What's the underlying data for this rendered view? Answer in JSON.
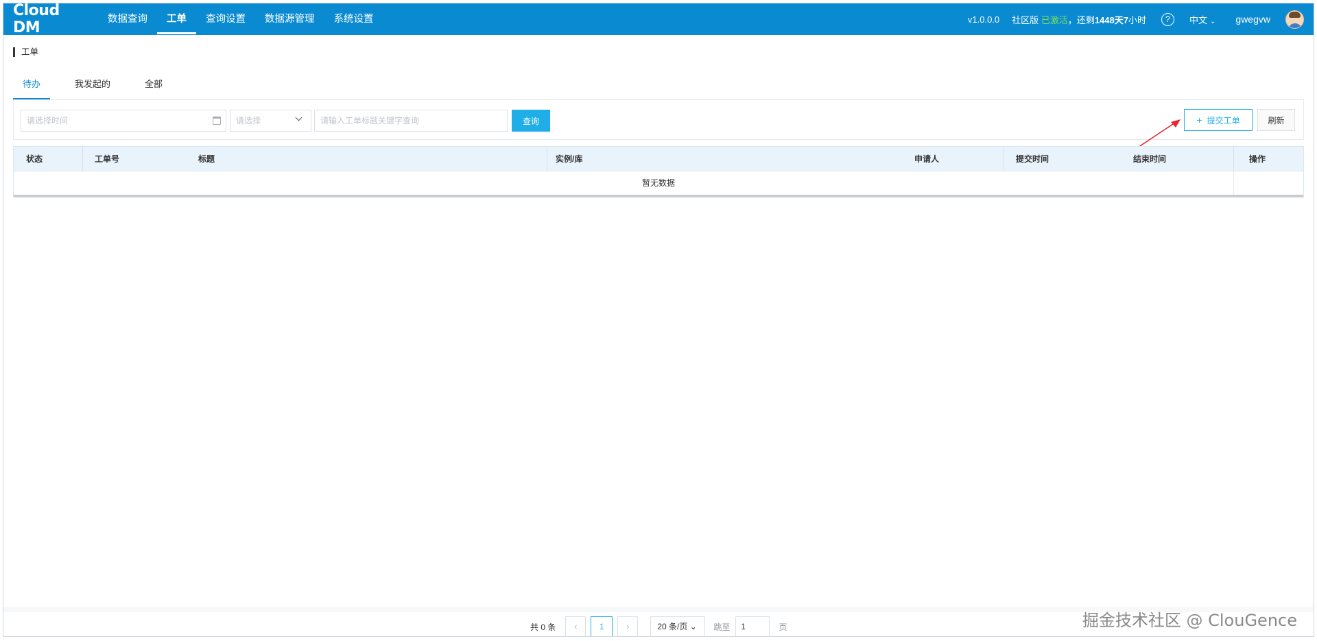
{
  "app": {
    "logo": "Cloud DM"
  },
  "nav": {
    "items": [
      {
        "label": "数据查询"
      },
      {
        "label": "工单"
      },
      {
        "label": "查询设置"
      },
      {
        "label": "数据源管理"
      },
      {
        "label": "系统设置"
      }
    ],
    "active": "工单"
  },
  "header": {
    "version": "v1.0.0.0",
    "edition_label": "社区版",
    "edition_state": "已激活",
    "remaining_prefix": "，还剩",
    "remaining_value": "1448天7",
    "remaining_suffix": "小时",
    "language": "中文",
    "username": "gwegvw"
  },
  "page": {
    "title": "工单"
  },
  "tabs": [
    {
      "label": "待办"
    },
    {
      "label": "我发起的"
    },
    {
      "label": "全部"
    }
  ],
  "filters": {
    "date_placeholder": "请选择时间",
    "select_placeholder": "请选择",
    "keyword_placeholder": "请输入工单标题关键字查询",
    "query_label": "查询",
    "submit_label": "提交工单",
    "refresh_label": "刷新"
  },
  "table": {
    "columns": [
      "状态",
      "工单号",
      "标题",
      "实例/库",
      "申请人",
      "提交时间",
      "结束时间",
      "操作"
    ],
    "empty_text": "暂无数据"
  },
  "pagination": {
    "total_text": "共 0 条",
    "current_page": "1",
    "page_size": "20 条/页",
    "goto_label": "跳至",
    "goto_value": "1",
    "page_suffix": "页"
  },
  "watermark": "掘金技术社区 @ ClouGence",
  "colors": {
    "primary": "#0a8ad0",
    "accent": "#1faee8",
    "active_state": "#7ee05b",
    "annotation": "#e8262c"
  }
}
